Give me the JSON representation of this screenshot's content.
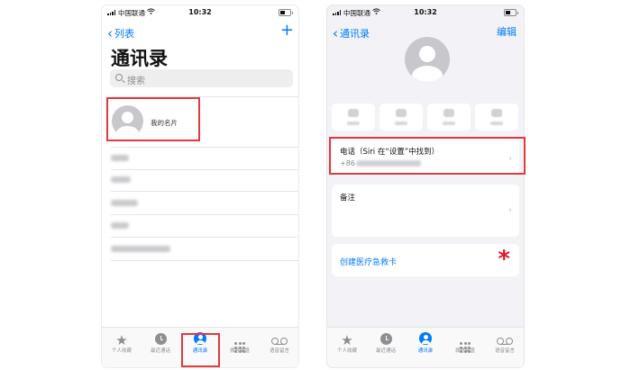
{
  "status_bar": {
    "carrier": "中国联通",
    "time": "10:32"
  },
  "left_screen": {
    "back_label": "列表",
    "add_label": "+",
    "title": "通讯录",
    "search_placeholder": "搜索",
    "my_card_label": "我的名片"
  },
  "right_screen": {
    "back_label": "通讯录",
    "edit_label": "编辑",
    "phone_card_title": "电话（Siri 在“设置”中找到）",
    "phone_number_prefix": "+86",
    "notes_title": "备注",
    "medical_id_link": "创建医疗急救卡",
    "asterisk": "*"
  },
  "tab_bar": {
    "tabs": [
      {
        "label": "个人收藏",
        "icon": "star-icon"
      },
      {
        "label": "最近通话",
        "icon": "clock-icon"
      },
      {
        "label": "通讯录",
        "icon": "person-circle-icon"
      },
      {
        "label": "拨号键盘",
        "icon": "keypad-icon"
      },
      {
        "label": "语音留言",
        "icon": "voicemail-icon"
      }
    ],
    "active": "通讯录"
  },
  "colors": {
    "accent": "#007aff",
    "highlight": "#e0393e",
    "asterisk": "#e5132b",
    "inactive_icon": "#8e8e93"
  }
}
